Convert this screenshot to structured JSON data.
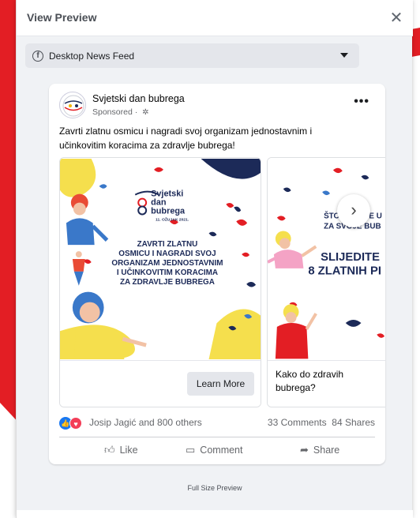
{
  "dialog": {
    "title": "View Preview",
    "close_icon": "close-icon"
  },
  "placement": {
    "label": "Desktop News Feed",
    "icon": "facebook-icon"
  },
  "post": {
    "page_name": "Svjetski dan bubrega",
    "sponsored_label": "Sponsored · ",
    "more_label": "•••",
    "text": "Zavrti zlatnu osmicu i nagradi svoj organizam jednostavnim i učinkovitim koracima za zdravlje bubrega!",
    "carousel": [
      {
        "logo_line1": "Svjetski",
        "logo_line2": "dan",
        "logo_line3": "bubrega",
        "date": "11. OŽUJAK 2021.",
        "headline": [
          "ZAVRTI ZLATNU",
          "OSMICU I NAGRADI SVOJ",
          "ORGANIZAM JEDNOSTAVNIM",
          "I UČINKOVITIM KORACIMA",
          "ZA ZDRAVLJE BUBREGA"
        ],
        "cta": "Learn More"
      },
      {
        "headline_top": [
          "ŠTO MOŽETE U",
          "ZA SVOJE BUB"
        ],
        "headline_big": [
          "SLIJEDITE",
          "8 ZLATNIH PI"
        ],
        "title": "Kako do zdravih bubrega?"
      }
    ],
    "reactions_text": "Josip Jagić and 800 others",
    "comments": "33 Comments",
    "shares": "84 Shares",
    "like_label": "Like",
    "comment_label": "Comment",
    "share_label": "Share"
  },
  "footer": {
    "full_size_label": "Full Size Preview"
  },
  "colors": {
    "brand_red": "#e31e24",
    "fb_blue": "#1877f2",
    "love_red": "#f33e58",
    "dark_navy": "#1c2a58"
  }
}
